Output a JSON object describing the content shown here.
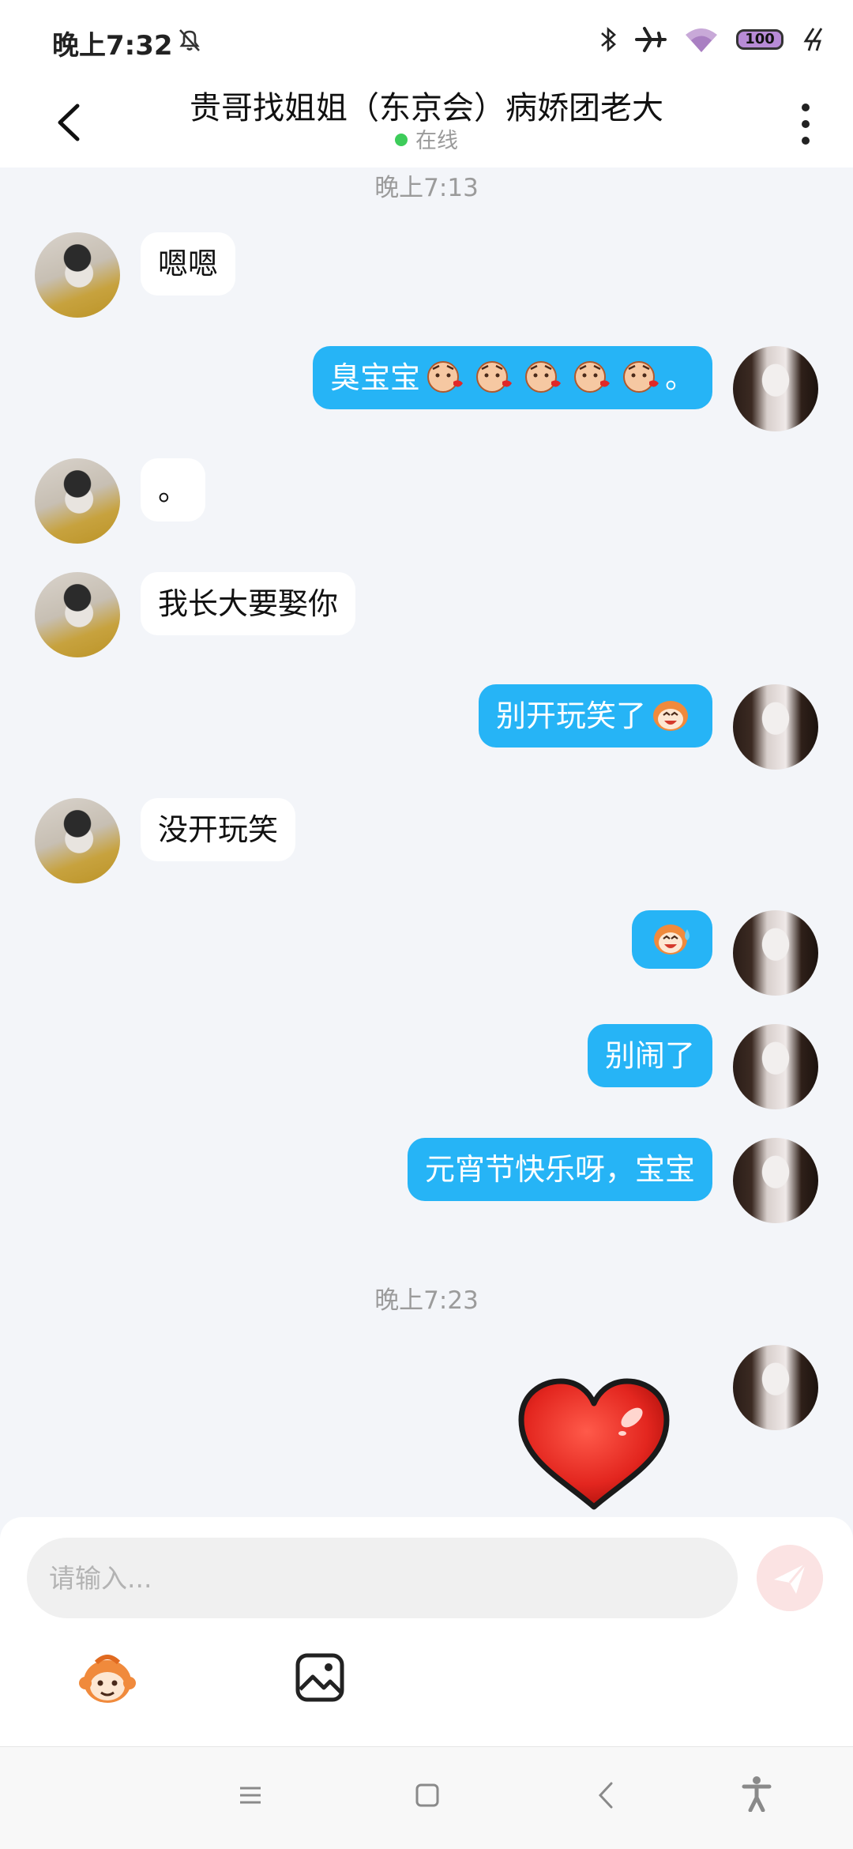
{
  "status_bar": {
    "time": "晚上7:32",
    "battery": "100",
    "colors": {
      "battery_fill": "#b78bd6"
    }
  },
  "header": {
    "title": "贵哥找姐姐（东京会）病娇团老大",
    "online_status": "在线"
  },
  "chat": {
    "time_dividers": [
      "晚上7:13",
      "晚上7:23"
    ],
    "messages": [
      {
        "side": "in",
        "text": "嗯嗯"
      },
      {
        "side": "out",
        "text": "臭宝宝",
        "suffix": "。",
        "sticker": "pig-kiss-emoji",
        "sticker_count": 5
      },
      {
        "side": "in",
        "text": "。"
      },
      {
        "side": "in",
        "text": "我长大要娶你"
      },
      {
        "side": "out",
        "text": "别开玩笑了",
        "sticker": "monkey-laugh-emoji"
      },
      {
        "side": "in",
        "text": "没开玩笑"
      },
      {
        "side": "out",
        "text": "",
        "sticker": "monkey-sweat-emoji"
      },
      {
        "side": "out",
        "text": "别闹了"
      },
      {
        "side": "out",
        "text": "元宵节快乐呀，宝宝"
      },
      {
        "side": "out",
        "text": "",
        "sticker": "red-heart-sticker"
      }
    ]
  },
  "input": {
    "placeholder": "请输入..."
  },
  "toolbar": {
    "icons": [
      "monkey-emoji-icon",
      "image-icon"
    ]
  },
  "nav_bar": {
    "icons": [
      "menu-icon",
      "home-icon",
      "back-icon",
      "accessibility-icon"
    ]
  },
  "colors": {
    "accent": "#26b4f6",
    "online": "#3dcc5a",
    "send_button": "#fbe3e3"
  }
}
